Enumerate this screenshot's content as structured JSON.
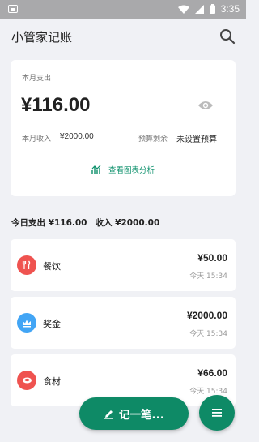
{
  "status_bar": {
    "time": "3:35"
  },
  "app_bar": {
    "title": "小管家记账"
  },
  "summary": {
    "month_expense_label": "本月支出",
    "month_expense_value": "¥116.00",
    "income_label": "本月收入",
    "income_value": "¥2000.00",
    "budget_label": "预算剩余",
    "budget_value": "未设置预算",
    "chart_link": "查看图表分析"
  },
  "today": {
    "expense_text": "今日支出 ¥116.00",
    "income_text": "收入 ¥2000.00"
  },
  "records": [
    {
      "category": "餐饮",
      "amount": "¥50.00",
      "time": "今天 15:34",
      "icon": "fork-knife-icon",
      "color": "#ef5350"
    },
    {
      "category": "奖金",
      "amount": "¥2000.00",
      "time": "今天 15:34",
      "icon": "crown-icon",
      "color": "#42a5f5"
    },
    {
      "category": "食材",
      "amount": "¥66.00",
      "time": "今天 15:34",
      "icon": "food-icon",
      "color": "#ef5350"
    }
  ],
  "fab": {
    "add_label": "记一笔..."
  },
  "colors": {
    "accent": "#0e8a66",
    "background": "#f0f1f5"
  }
}
